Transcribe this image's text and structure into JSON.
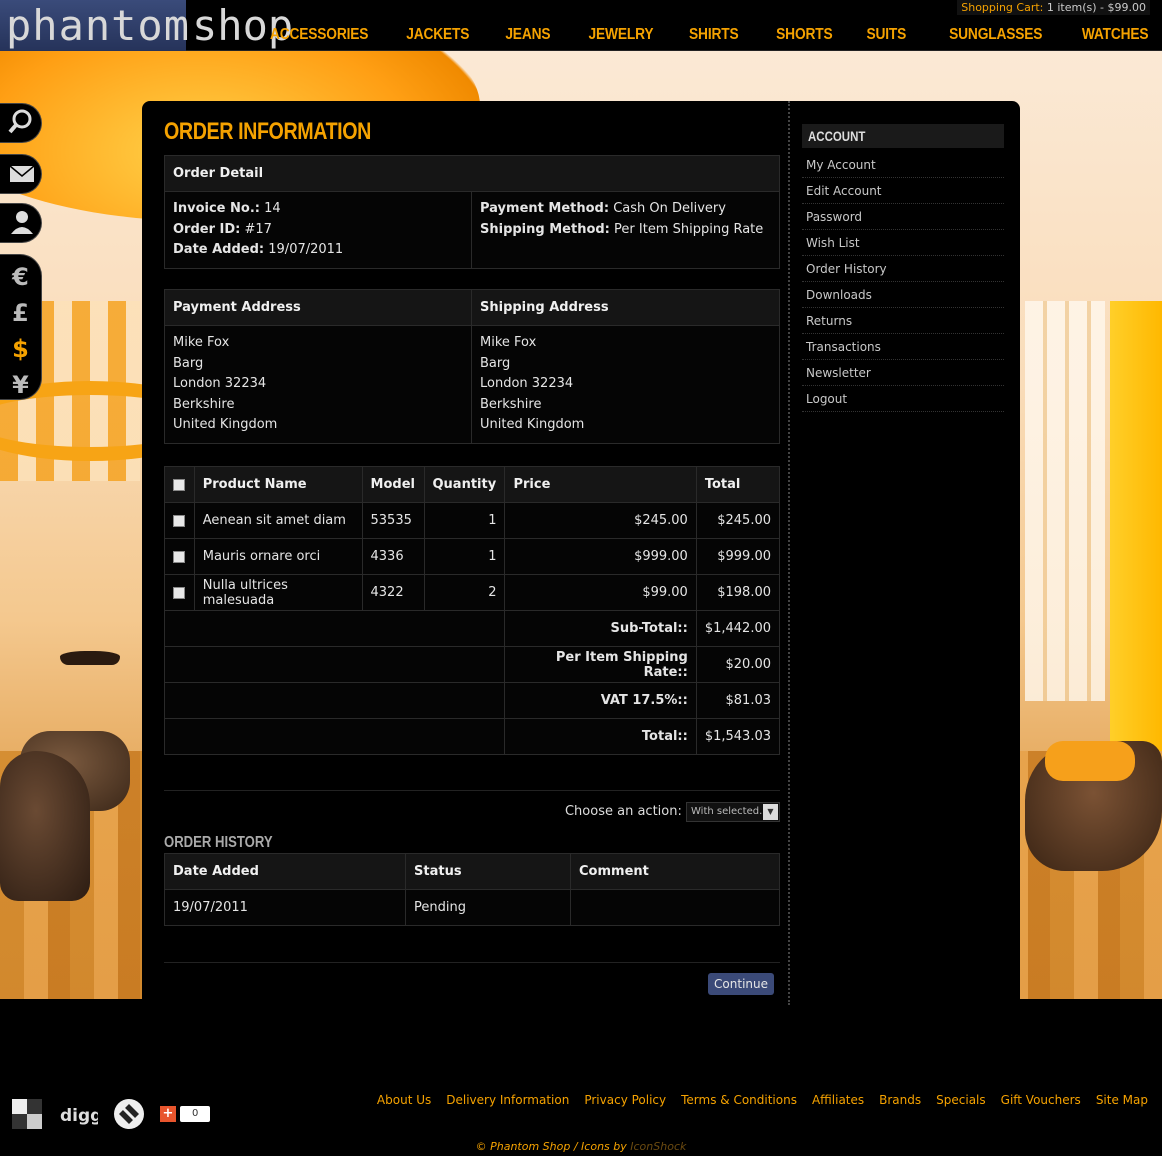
{
  "header": {
    "logo_part1": "phantom",
    "logo_part2": "shop",
    "cart_label": "Shopping Cart:",
    "cart_summary": "1 item(s) - $99.00",
    "nav": [
      "ACCESSORIES",
      "JACKETS",
      "JEANS",
      "JEWELRY",
      "SHIRTS",
      "SHORTS",
      "SUITS",
      "SUNGLASSES",
      "WATCHES"
    ]
  },
  "side_tabs": {
    "icons": [
      "search-icon",
      "mail-icon",
      "user-icon"
    ],
    "currencies": [
      "€",
      "£",
      "$",
      "¥"
    ],
    "active_currency": "$"
  },
  "page": {
    "title": "ORDER INFORMATION"
  },
  "order_detail": {
    "header": "Order Detail",
    "invoice_label": "Invoice No.:",
    "invoice_value": "14",
    "order_id_label": "Order ID:",
    "order_id_value": "#17",
    "date_added_label": "Date Added:",
    "date_added_value": "19/07/2011",
    "payment_method_label": "Payment Method:",
    "payment_method_value": "Cash On Delivery",
    "shipping_method_label": "Shipping Method:",
    "shipping_method_value": "Per Item Shipping Rate"
  },
  "addresses": {
    "payment_header": "Payment Address",
    "shipping_header": "Shipping Address",
    "payment": [
      "Mike Fox",
      "Barg",
      "London 32234",
      "Berkshire",
      "United Kingdom"
    ],
    "shipping": [
      "Mike Fox",
      "Barg",
      "London 32234",
      "Berkshire",
      "United Kingdom"
    ]
  },
  "products": {
    "headers": {
      "name": "Product Name",
      "model": "Model",
      "quantity": "Quantity",
      "price": "Price",
      "total": "Total"
    },
    "rows": [
      {
        "name": "Aenean sit amet diam",
        "model": "53535",
        "quantity": "1",
        "price": "$245.00",
        "total": "$245.00"
      },
      {
        "name": "Mauris ornare orci",
        "model": "4336",
        "quantity": "1",
        "price": "$999.00",
        "total": "$999.00"
      },
      {
        "name": "Nulla ultrices malesuada",
        "model": "4322",
        "quantity": "2",
        "price": "$99.00",
        "total": "$198.00"
      }
    ],
    "totals": [
      {
        "label": "Sub-Total::",
        "value": "$1,442.00"
      },
      {
        "label": "Per Item Shipping Rate::",
        "value": "$20.00"
      },
      {
        "label": "VAT 17.5%::",
        "value": "$81.03"
      },
      {
        "label": "Total::",
        "value": "$1,543.03"
      }
    ]
  },
  "action": {
    "label": "Choose an action:",
    "select_value": "With selected.."
  },
  "history": {
    "title": "ORDER HISTORY",
    "headers": {
      "date": "Date Added",
      "status": "Status",
      "comment": "Comment"
    },
    "rows": [
      {
        "date": "19/07/2011",
        "status": "Pending",
        "comment": ""
      }
    ]
  },
  "continue_label": "Continue",
  "sidebar": {
    "title": "ACCOUNT",
    "items": [
      "My Account",
      "Edit Account",
      "Password",
      "Wish List",
      "Order History",
      "Downloads",
      "Returns",
      "Transactions",
      "Newsletter",
      "Logout"
    ]
  },
  "footer": {
    "social_counter": "0",
    "links": [
      "About Us",
      "Delivery Information",
      "Privacy Policy",
      "Terms & Conditions",
      "Affiliates",
      "Brands",
      "Specials",
      "Gift Vouchers",
      "Site Map"
    ],
    "copyright_main": "© Phantom Shop / Icons by ",
    "copyright_credit": "IconShock"
  },
  "colors": {
    "accent": "#f5a200",
    "button": "#3b4a78",
    "panel": "#000000"
  }
}
